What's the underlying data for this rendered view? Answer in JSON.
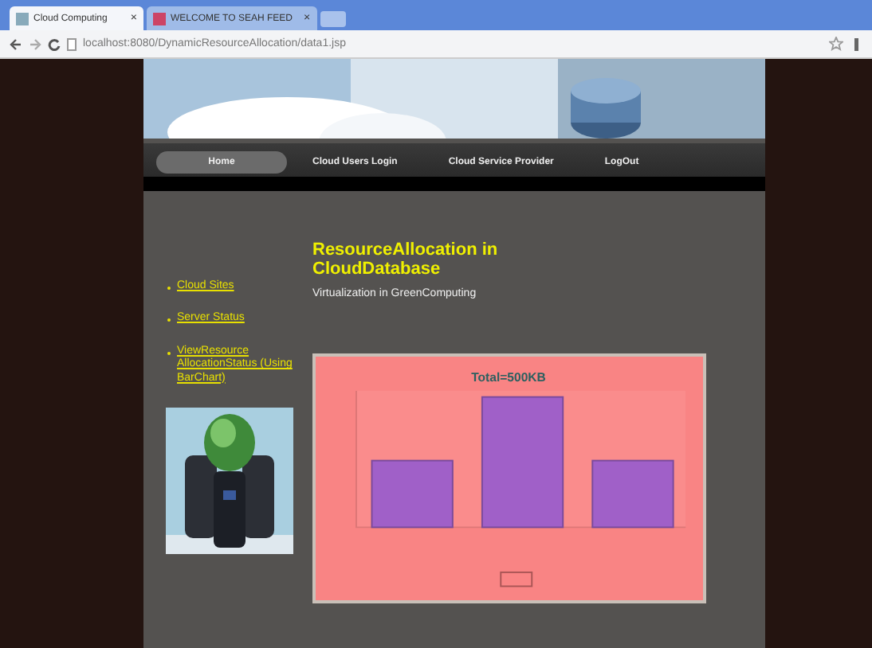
{
  "browser": {
    "tabs": [
      {
        "label": "Cloud Computing",
        "selected": true
      },
      {
        "label": "WELCOME TO SEAH FEED",
        "selected": false
      }
    ],
    "close_icon": "×",
    "address": "localhost:8080/DynamicResourceAllocation/data1.jsp"
  },
  "nav": {
    "items": [
      {
        "label": "Home",
        "selected": true
      },
      {
        "label": "Cloud Users Login",
        "selected": false
      },
      {
        "label": "Cloud Service Provider",
        "selected": false
      },
      {
        "label": "LogOut",
        "selected": false
      }
    ]
  },
  "sidebar": {
    "links": [
      "Cloud Sites",
      "Server Status",
      "ViewResource AllocationStatus (Using BarChart)"
    ]
  },
  "heading": "ResourceAllocation in CloudDatabase",
  "subheading": "Virtualization in GreenComputing",
  "chart": {
    "title": "Total=500KB"
  }
}
